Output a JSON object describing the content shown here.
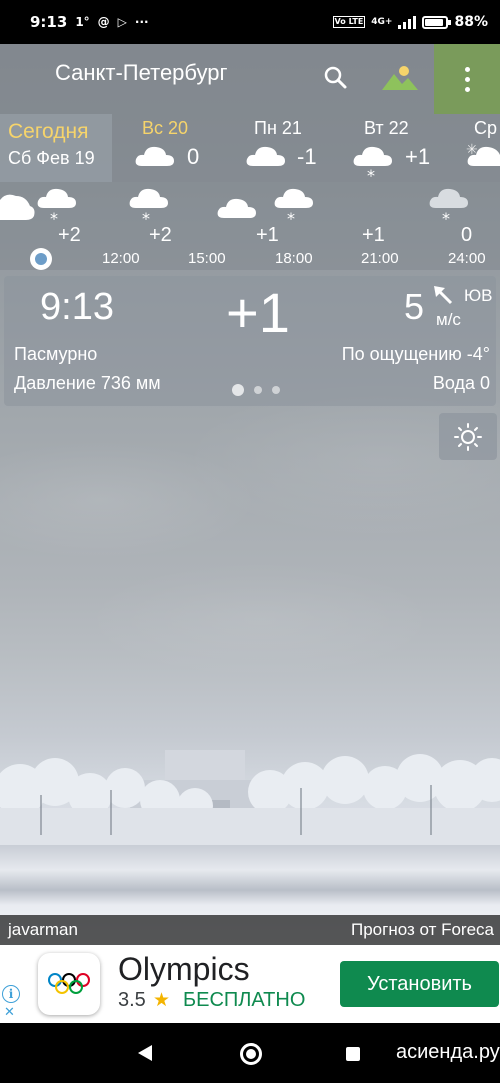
{
  "status_bar": {
    "time": "9:13",
    "temp_indicator": "1°",
    "network": "4G+",
    "volte": "Vo LTE",
    "battery": "88%"
  },
  "toolbar": {
    "city": "Санкт-Петербург",
    "search_icon": "search-icon",
    "landscape_icon": "landscape-icon",
    "menu_icon": "more-vert-icon",
    "menu_color": "#7a9b5b"
  },
  "days": {
    "today_label": "Сегодня",
    "today_date": "Сб Фев 19",
    "items": [
      {
        "name": "Вс 20",
        "temp": "0",
        "weekend": true
      },
      {
        "name": "Пн 21",
        "temp": "-1",
        "weekend": false
      },
      {
        "name": "Вт 22",
        "temp": "+1",
        "weekend": false
      },
      {
        "name": "Ср",
        "temp": "",
        "weekend": false
      }
    ]
  },
  "hourly": {
    "temps": [
      "+2",
      "+2",
      "+1",
      "+1",
      "0"
    ],
    "times": [
      "12:00",
      "15:00",
      "18:00",
      "21:00",
      "24:00"
    ]
  },
  "current": {
    "time": "9:13",
    "temp": "+1",
    "wind_speed": "5",
    "wind_dir": "ЮВ",
    "wind_unit": "м/с",
    "condition": "Пасмурно",
    "feels_like": "По ощущению -4°",
    "pressure": "Давление 736 мм",
    "water": "Вода 0"
  },
  "credits": {
    "photographer": "javarman",
    "provider": "Прогноз от Foreca"
  },
  "ad": {
    "title": "Olympics",
    "rating": "3.5",
    "price": "БЕСПЛАТНО",
    "install_label": "Установить",
    "install_color": "#0f8a4f"
  },
  "navbar": {
    "watermark": "асиенда.ру"
  },
  "colors": {
    "accent_yellow": "#f6d46b",
    "now_dot": "#6d9dc8"
  }
}
